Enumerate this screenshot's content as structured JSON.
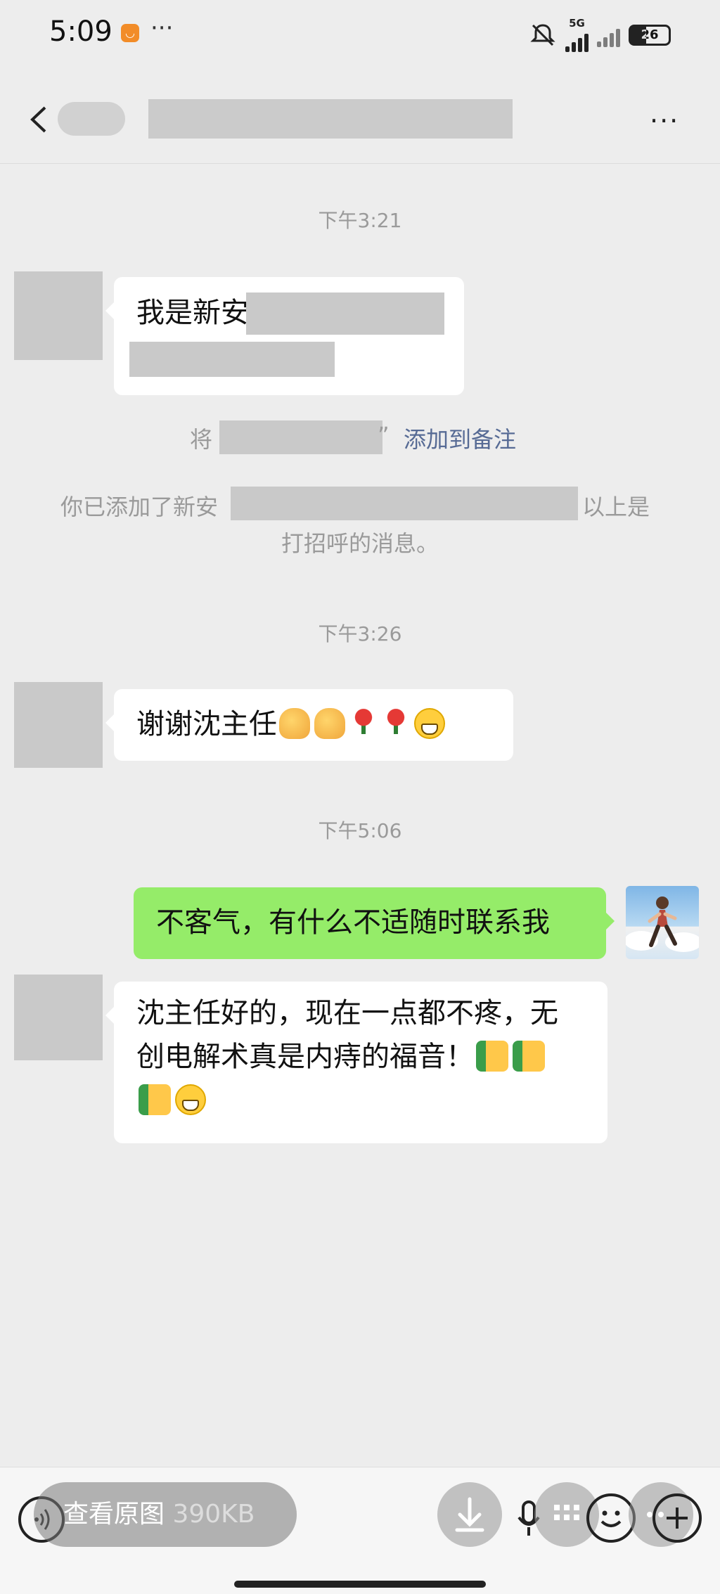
{
  "status_bar": {
    "time": "5:09",
    "more": "···",
    "signal_label": "5G",
    "battery": "26"
  },
  "header": {
    "menu": "···"
  },
  "chat": {
    "ts1": "下午3:21",
    "msg1_visible": "我是新安",
    "sys_note_prefix": "将",
    "sys_note_suffix": "”",
    "sys_note_link": "添加到备注",
    "sys_added_prefix": "你已添加了新安",
    "sys_added_suffix": "以上是",
    "sys_added_line2": "打招呼的消息。",
    "ts2": "下午3:26",
    "msg2": "谢谢沈主任",
    "ts3": "下午5:06",
    "msg3": "不客气，有什么不适随时联系我",
    "msg4_line1": "沈主任好的，现在一点都不疼，无",
    "msg4_line2": "创电解术真是内痔的福音！"
  },
  "bottom_bar": {
    "view_original": "查看原图",
    "size": "390KB"
  }
}
